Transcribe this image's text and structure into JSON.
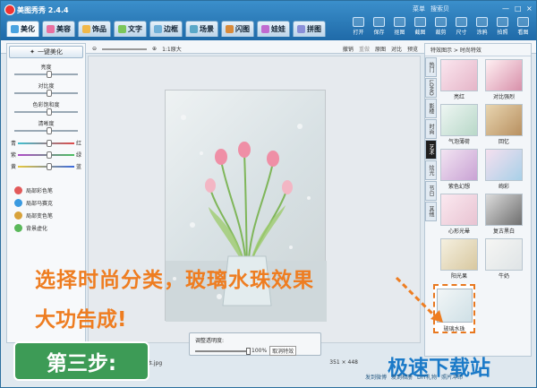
{
  "app": {
    "title": "美图秀秀 2.4.4",
    "menu": "菜单",
    "help": "搜索贝"
  },
  "tabs": [
    {
      "label": "美化",
      "color": "#4aa3e0"
    },
    {
      "label": "美容",
      "color": "#e86fa0"
    },
    {
      "label": "饰品",
      "color": "#f0b84a"
    },
    {
      "label": "文字",
      "color": "#7bc65a"
    },
    {
      "label": "边框",
      "color": "#6fb0d8"
    },
    {
      "label": "场景",
      "color": "#5aa8c8"
    },
    {
      "label": "闪图",
      "color": "#d88a3a"
    },
    {
      "label": "娃娃",
      "color": "#c06ad0"
    },
    {
      "label": "拼图",
      "color": "#8a8fd8"
    }
  ],
  "right_tools": [
    "打开",
    "保存",
    "抠图",
    "截图",
    "裁剪",
    "尺寸",
    "涂鸦",
    "拍照",
    "看图"
  ],
  "left_panel": {
    "onekey": "一键美化",
    "sliders": [
      {
        "label": "亮度",
        "value": 0.5
      },
      {
        "label": "对比度",
        "value": 0.5
      },
      {
        "label": "色彩饱和度",
        "value": 0.5
      },
      {
        "label": "清晰度",
        "value": 0.5
      }
    ],
    "color_sliders": [
      {
        "left": "青",
        "right": "红",
        "value": 0.5
      },
      {
        "left": "紫",
        "right": "绿",
        "value": 0.5
      },
      {
        "left": "黄",
        "right": "蓝",
        "value": 0.5
      }
    ],
    "tools": [
      "局部彩色笔",
      "局部马赛克",
      "局部变色笔",
      "背景虚化"
    ]
  },
  "canvas_toolbar": {
    "zoom": "1:1原大",
    "undo": "撤销",
    "redo": "重做",
    "original": "原图",
    "compare": "对比",
    "preview": "预览"
  },
  "opacity": {
    "label": "调整透明度:",
    "value": "100%",
    "cancel": "取消特效"
  },
  "status": {
    "filename": "副本.jpg",
    "size": "351 × 448"
  },
  "right_panel": {
    "header": "特效图示 > 时尚特效",
    "vtabs": [
      "热门",
      "LOMO",
      "影楼",
      "时尚",
      "艺术",
      "炫光",
      "节日",
      "其他"
    ],
    "effects": [
      {
        "name": "亮红"
      },
      {
        "name": "对比强烈"
      },
      {
        "name": "气泡薄荷"
      },
      {
        "name": "回忆"
      },
      {
        "name": "紫色幻想"
      },
      {
        "name": "绚彩"
      },
      {
        "name": "心形光晕"
      },
      {
        "name": "复古黑白"
      },
      {
        "name": "阳光果"
      },
      {
        "name": "牛奶"
      },
      {
        "name": "玻璃水珠"
      }
    ]
  },
  "overlay": {
    "line1": "选择时尚分类，玻璃水珠效果",
    "line2": "大功告成!",
    "step": "第三步:",
    "watermark": "极速下载站"
  },
  "bottom": [
    "发到微博",
    "发到相册",
    "DIY礼物",
    "照片冲印"
  ]
}
